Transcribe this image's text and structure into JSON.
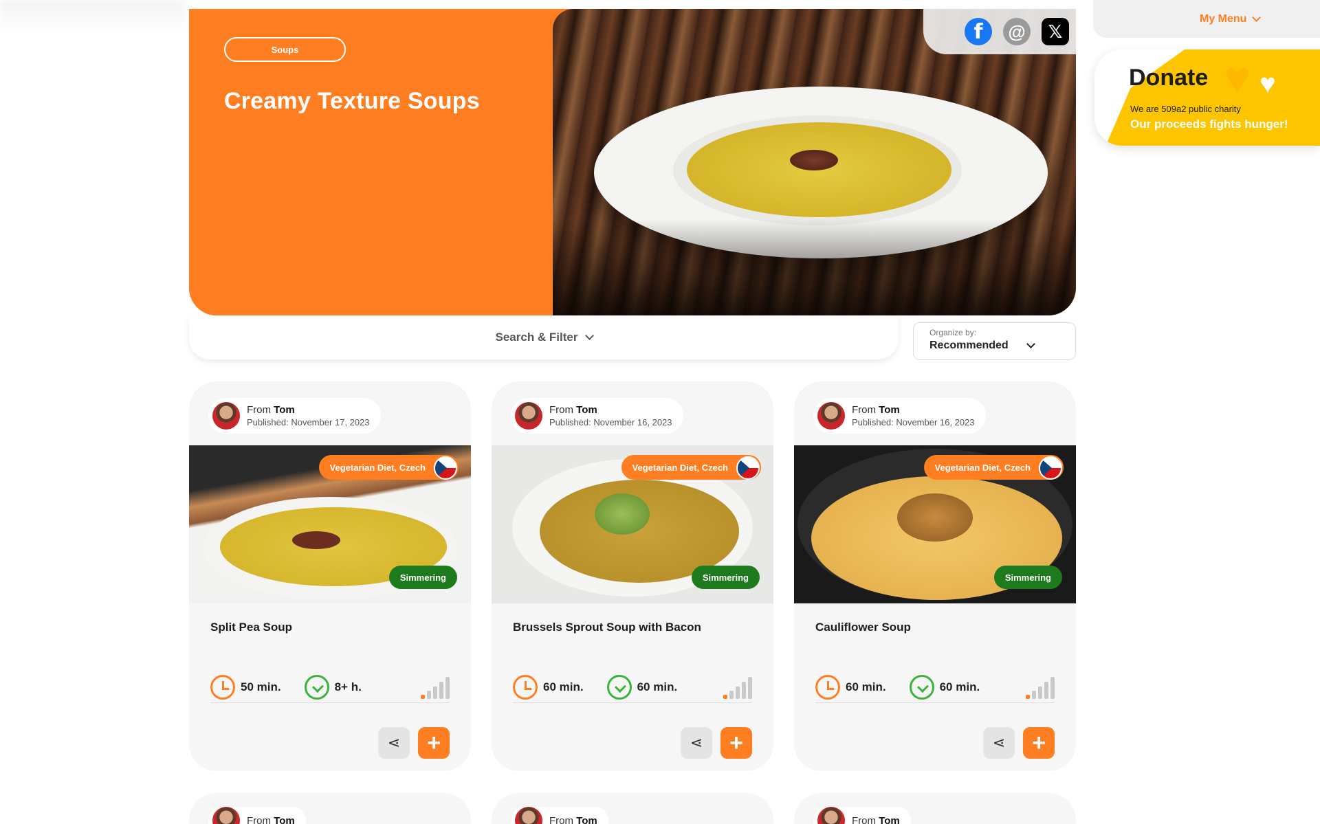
{
  "header": {
    "my_menu_label": "My Menu"
  },
  "hero": {
    "category": "Soups",
    "title": "Creamy Texture Soups"
  },
  "share": {
    "icons": [
      "facebook-icon",
      "at-sign-icon",
      "x-icon"
    ]
  },
  "donate": {
    "title": "Donate",
    "subtitle": "We are 509a2 public charity",
    "cta": "Our proceeds fights hunger!"
  },
  "filter": {
    "label": "Search & Filter"
  },
  "organize": {
    "label": "Organize by:",
    "value": "Recommended"
  },
  "cards": [
    {
      "from": "From",
      "author": "Tom",
      "published": "Published: November 17, 2023",
      "diet": "Vegetarian Diet, Czech",
      "status": "Simmering",
      "title": "Split Pea Soup",
      "prep_time": "50 min.",
      "total_time": "8+ h.",
      "difficulty_level": 1
    },
    {
      "from": "From",
      "author": "Tom",
      "published": "Published: November 16, 2023",
      "diet": "Vegetarian Diet, Czech",
      "status": "Simmering",
      "title": "Brussels Sprout Soup with Bacon",
      "prep_time": "60 min.",
      "total_time": "60 min.",
      "difficulty_level": 1
    },
    {
      "from": "From",
      "author": "Tom",
      "published": "Published: November 16, 2023",
      "diet": "Vegetarian Diet, Czech",
      "status": "Simmering",
      "title": "Cauliflower Soup",
      "prep_time": "60 min.",
      "total_time": "60 min.",
      "difficulty_level": 1
    }
  ],
  "peek_cards": [
    {
      "from": "From",
      "author": "Tom"
    },
    {
      "from": "From",
      "author": "Tom"
    },
    {
      "from": "From",
      "author": "Tom"
    }
  ],
  "colors": {
    "accent": "#ff7e22",
    "status_green": "#1d7a1d",
    "donate_yellow": "#fdc500"
  }
}
